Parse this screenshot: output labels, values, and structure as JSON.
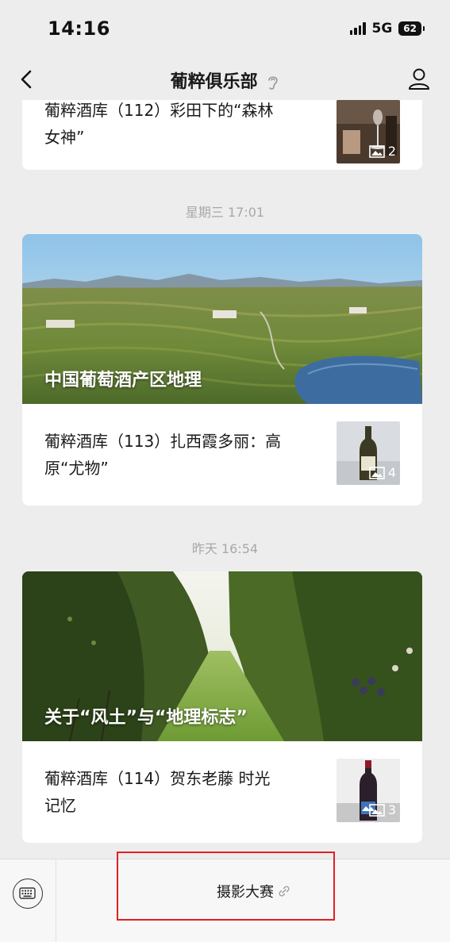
{
  "status_bar": {
    "time": "14:16",
    "network": "5G",
    "battery": "62"
  },
  "nav": {
    "title": "葡粹俱乐部"
  },
  "feed": {
    "partial_card": {
      "title": "葡粹酒库（112）彩田下的“森林女神”",
      "line1": "葡粹酒库（112）彩田下的“森林",
      "line2": "女神”",
      "image_count": "2"
    },
    "groups": [
      {
        "timestamp": "星期三 17:01",
        "cover_title": "中国葡萄酒产区地理",
        "sub_line1": "葡粹酒库（113）扎西霞多丽：高",
        "sub_line2": "原“尤物”",
        "image_count": "4"
      },
      {
        "timestamp": "昨天 16:54",
        "cover_title": "关于“风土”与“地理标志”",
        "sub_line1": "葡粹酒库（114）贺东老藤 时光",
        "sub_line2": "记忆",
        "image_count": "3"
      }
    ]
  },
  "bottom_menu": {
    "item_label": "摄影大赛"
  },
  "colors": {
    "background": "#ededed",
    "highlight": "#e02020",
    "timestamp": "#a8a8a8"
  },
  "icons": [
    "back-chevron-icon",
    "ear-icon",
    "profile-icon",
    "image-icon",
    "keyboard-icon",
    "link-icon"
  ]
}
